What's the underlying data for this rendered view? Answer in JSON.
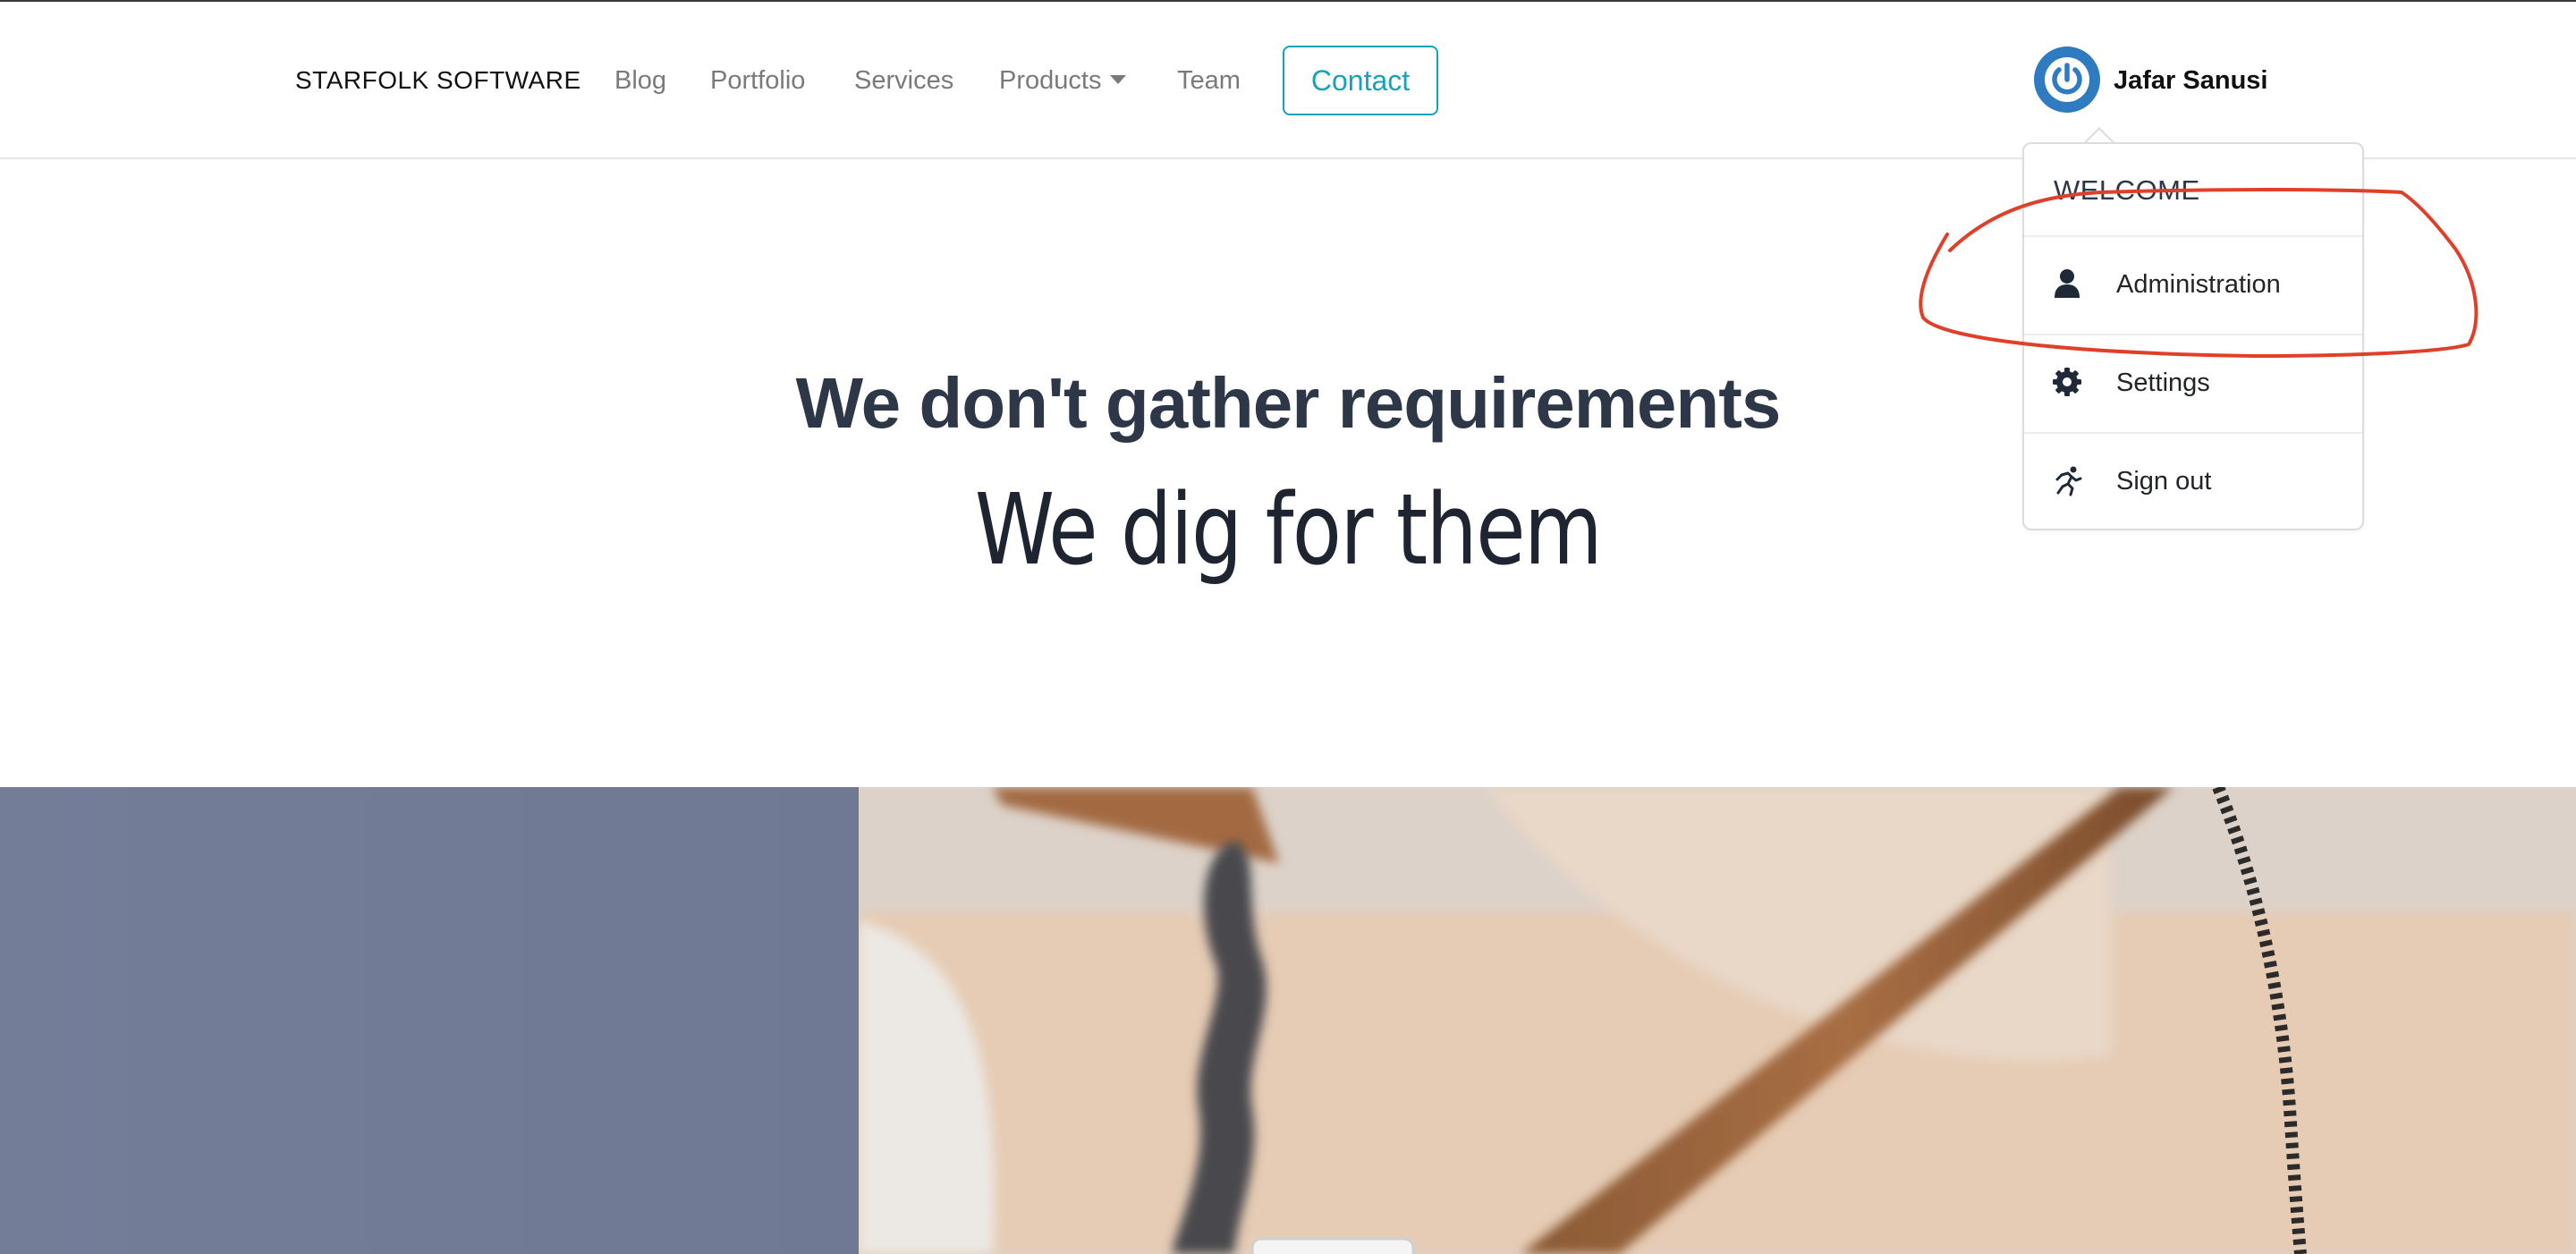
{
  "navbar": {
    "brand": "STARFOLK SOFTWARE",
    "links": [
      "Blog",
      "Portfolio",
      "Services",
      "Products",
      "Team"
    ],
    "contact_label": "Contact",
    "user_name": "Jafar Sanusi"
  },
  "dropdown": {
    "header": "WELCOME",
    "items": [
      {
        "label": "Administration",
        "icon": "user-icon"
      },
      {
        "label": "Settings",
        "icon": "gear-icon"
      },
      {
        "label": "Sign out",
        "icon": "running-person-icon"
      }
    ]
  },
  "hero": {
    "title": "We don't gather requirements",
    "subtitle": "We dig for them"
  },
  "colors": {
    "accent": "#17a2b8",
    "avatar": "#2f7bc1",
    "annotation": "#e0402a",
    "heading": "#2d3748",
    "left_panel": "#737d98"
  }
}
